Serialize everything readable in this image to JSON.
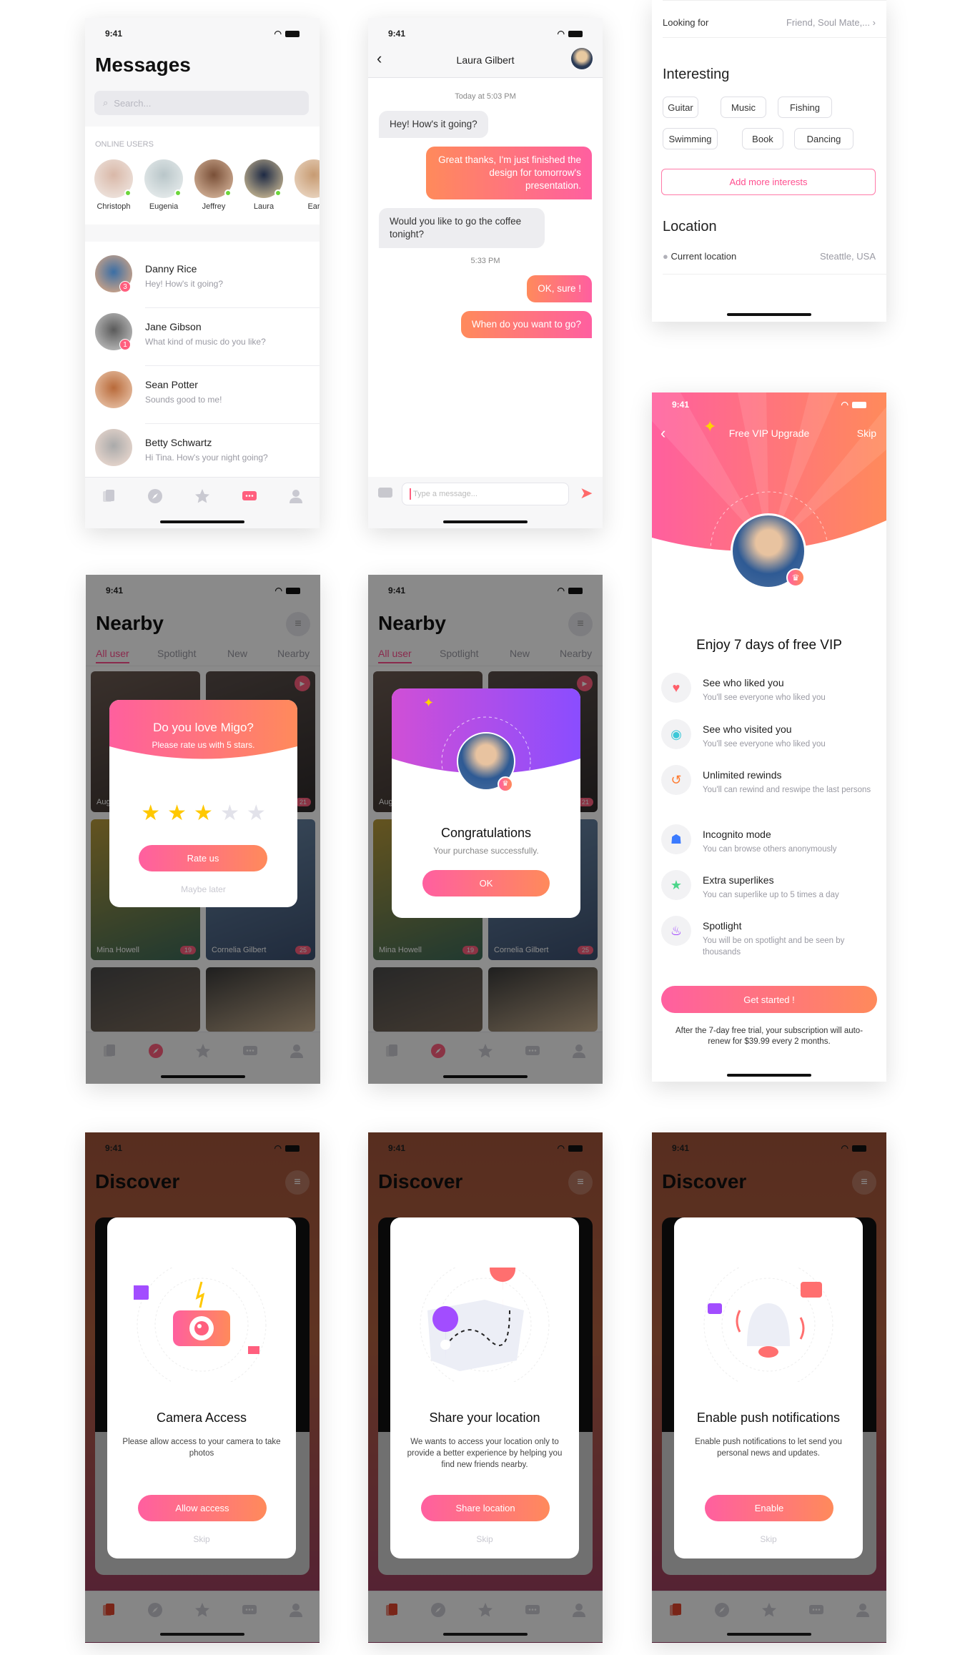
{
  "status_time": "9:41",
  "colors": {
    "accent_pink": "#ff5fa0",
    "accent_orange": "#ff8a5b",
    "vip_purple": "#8a4dff",
    "online_green": "#6cd63a",
    "star_yellow": "#ffc800"
  },
  "messages": {
    "title": "Messages",
    "search_placeholder": "Search...",
    "online_label": "ONLINE USERS",
    "online_users": [
      {
        "name": "Christoph"
      },
      {
        "name": "Eugenia"
      },
      {
        "name": "Jeffrey"
      },
      {
        "name": "Laura"
      },
      {
        "name": "Ear"
      }
    ],
    "conversations": [
      {
        "name": "Danny Rice",
        "preview": "Hey! How's it going?",
        "unread": "3"
      },
      {
        "name": "Jane Gibson",
        "preview": "What kind of music do you like?",
        "unread": "1"
      },
      {
        "name": "Sean Potter",
        "preview": "Sounds good to me!",
        "unread": ""
      },
      {
        "name": "Betty Schwartz",
        "preview": "Hi Tina. How's your night going?",
        "unread": ""
      }
    ]
  },
  "chat": {
    "contact": "Laura Gilbert",
    "items": [
      {
        "type": "time",
        "text": "Today at 5:03 PM"
      },
      {
        "type": "in",
        "text": "Hey! How's it going?"
      },
      {
        "type": "out",
        "text": "Great thanks, I'm just finished the design for tomorrow's presentation."
      },
      {
        "type": "in",
        "text": "Would you like to go the coffee tonight?"
      },
      {
        "type": "time",
        "text": "5:33 PM"
      },
      {
        "type": "out",
        "text": "OK, sure !"
      },
      {
        "type": "out",
        "text": "When do you want to go?"
      }
    ],
    "input_placeholder": "Type a message..."
  },
  "profile": {
    "looking_for_label": "Looking for",
    "looking_for_value": "Friend, Soul Mate,...",
    "interests_title": "Interesting",
    "interests": [
      "Guitar",
      "Music",
      "Fishing",
      "Swimming",
      "Book",
      "Dancing"
    ],
    "add_interests": "Add more interests",
    "location_title": "Location",
    "current_location_label": "Current location",
    "current_location_value": "Steattle, USA"
  },
  "vip": {
    "header": "Free VIP Upgrade",
    "skip": "Skip",
    "title": "Enjoy 7 days of free VIP",
    "features": [
      {
        "icon": "heart-icon",
        "title": "See who liked you",
        "desc": "You'll see everyone who liked you"
      },
      {
        "icon": "eye-icon",
        "title": "See who visited you",
        "desc": "You'll see everyone who liked you"
      },
      {
        "icon": "rewind-icon",
        "title": "Unlimited rewinds",
        "desc": "You'll can rewind and reswipe the last persons"
      },
      {
        "icon": "incognito-icon",
        "title": "Incognito mode",
        "desc": "You can browse others anonymously"
      },
      {
        "icon": "star-icon",
        "title": "Extra superlikes",
        "desc": "You can superlike up to 5 times a day"
      },
      {
        "icon": "flame-icon",
        "title": "Spotlight",
        "desc": "You will be on spotlight and be seen by thousands"
      }
    ],
    "cta": "Get started !",
    "footer": "After the 7-day free trial, your subscription will auto-renew for $39.99 every 2 months."
  },
  "nearby": {
    "title": "Nearby",
    "tabs": [
      "All user",
      "Spotlight",
      "New",
      "Nearby"
    ],
    "cards": [
      {
        "name": "Aug",
        "badge": ""
      },
      {
        "name": "",
        "badge": "21"
      },
      {
        "name": "Mina Howell",
        "badge": "19"
      },
      {
        "name": "Cornelia Gilbert",
        "badge": "25"
      },
      {
        "name": "",
        "badge": ""
      },
      {
        "name": "",
        "badge": ""
      }
    ]
  },
  "rate_popup": {
    "title": "Do you love Migo?",
    "subtitle": "Please rate us with 5 stars.",
    "rating": 3,
    "max_rating": 5,
    "button": "Rate us",
    "later": "Maybe later"
  },
  "congrats_popup": {
    "title": "Congratulations",
    "subtitle": "Your purchase successfully.",
    "button": "OK"
  },
  "discover": {
    "title": "Discover"
  },
  "permissions": [
    {
      "illustration": "camera-illustration",
      "title": "Camera Access",
      "desc": "Please allow access to your camera to take photos",
      "button": "Allow access",
      "skip": "Skip"
    },
    {
      "illustration": "map-illustration",
      "title": "Share your location",
      "desc": "We wants to access your location only to provide a better experience by helping you find new friends nearby.",
      "button": "Share location",
      "skip": "Skip"
    },
    {
      "illustration": "bell-illustration",
      "title": "Enable push notifications",
      "desc": "Enable push notifications to let send you personal news and updates.",
      "button": "Enable",
      "skip": "Skip"
    }
  ]
}
